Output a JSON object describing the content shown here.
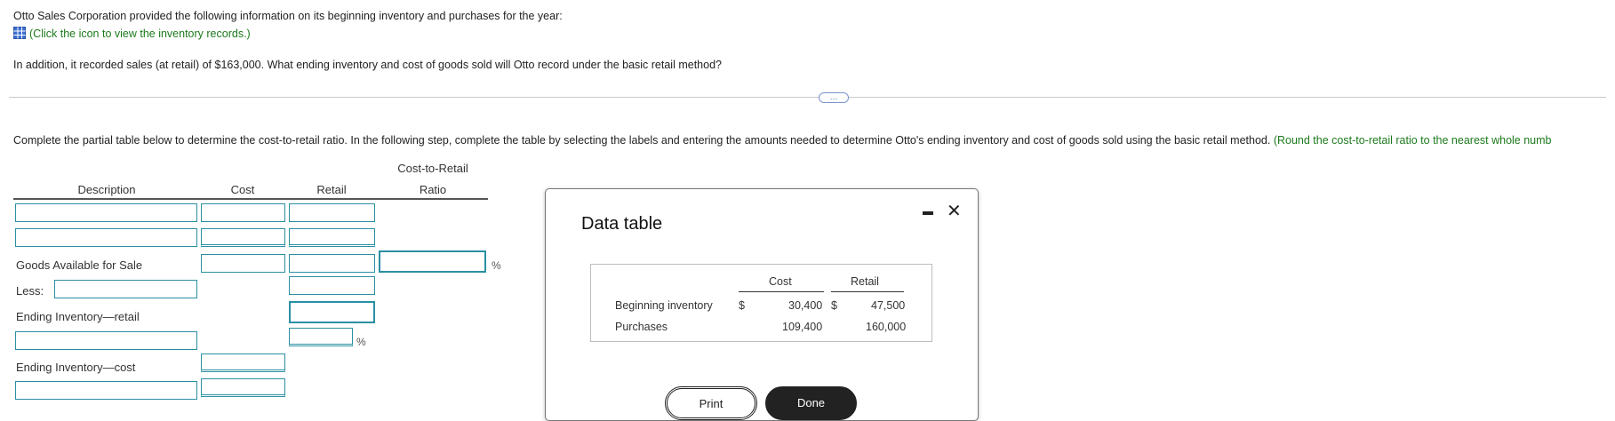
{
  "problem": {
    "line1": "Otto Sales Corporation provided the following information on its beginning inventory and purchases for the year:",
    "link_text": "(Click the icon to view the inventory records.)",
    "line2": "In addition, it recorded sales (at retail) of $163,000. What ending inventory and cost of goods sold will Otto record under the basic retail method?"
  },
  "expander_label": "…",
  "instructions": {
    "text": "Complete the partial table below to determine the cost-to-retail ratio. In the following step, complete the table by selecting the labels and entering the amounts needed to determine Otto's ending inventory and cost of goods sold using the basic retail method.",
    "hint": "(Round the cost-to-retail ratio to the nearest whole numb"
  },
  "table": {
    "headers": {
      "description": "Description",
      "cost": "Cost",
      "retail": "Retail",
      "ratio_line1": "Cost-to-Retail",
      "ratio_line2": "Ratio"
    },
    "labels": {
      "goods_available": "Goods Available for Sale",
      "less": "Less:",
      "ending_retail": "Ending Inventory—retail",
      "ending_cost": "Ending Inventory—cost"
    },
    "percent_sign": "%"
  },
  "modal": {
    "title": "Data table",
    "col_cost": "Cost",
    "col_retail": "Retail",
    "rows": [
      {
        "label": "Beginning inventory",
        "currency": "$",
        "cost": "30,400",
        "cost_currency": "$",
        "retail": "47,500"
      },
      {
        "label": "Purchases",
        "currency": "",
        "cost": "109,400",
        "cost_currency": "",
        "retail": "160,000"
      }
    ],
    "print_label": "Print",
    "done_label": "Done"
  }
}
